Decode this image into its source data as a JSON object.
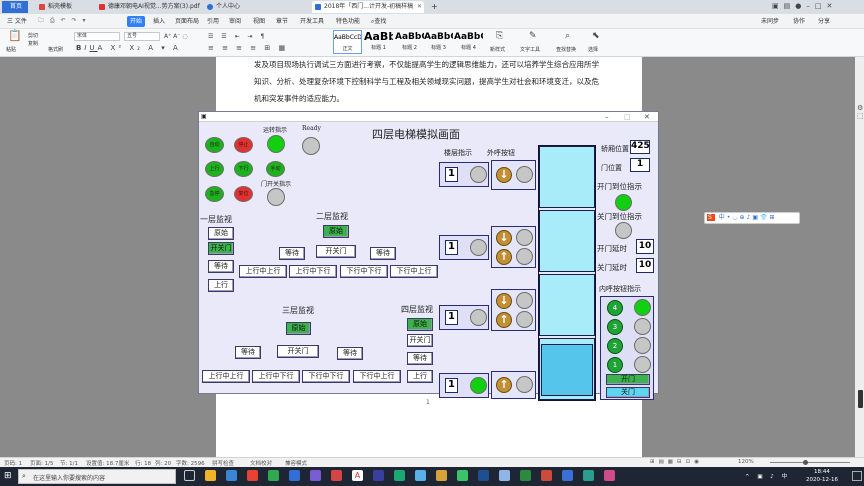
{
  "browser": {
    "tabs": [
      {
        "label": "首页",
        "active": false
      },
      {
        "label": "稻壳模板",
        "active": false
      },
      {
        "label": "德康邓朝电AI视觉...势方案(3).pdf",
        "active": false
      },
      {
        "label": "个人中心",
        "active": false
      },
      {
        "label": "2018年「西门...计开发-初稿样稿",
        "active": true
      }
    ],
    "new_tab": "+"
  },
  "menu": {
    "items": [
      "三 文件",
      "开始",
      "插入",
      "页面布局",
      "引用",
      "审阅",
      "视图",
      "章节",
      "开发工具",
      "特色功能"
    ],
    "active": "开始",
    "search_label": "查找",
    "right": [
      "未同步",
      "协作",
      "分享"
    ]
  },
  "ribbon": {
    "clipboard": [
      "粘贴",
      "剪切",
      "复制",
      "格式刷"
    ],
    "font_name": "宋体",
    "font_size": "五号",
    "styles": [
      {
        "sample": "AaBbCcDd",
        "name": "正文"
      },
      {
        "sample": "AaBb",
        "name": "标题 1"
      },
      {
        "sample": "AaBbC",
        "name": "标题 2"
      },
      {
        "sample": "AaBbC",
        "name": "标题 3"
      },
      {
        "sample": "AaBbC",
        "name": "标题 4"
      }
    ],
    "tools": [
      "新样式",
      "文字工具",
      "查找替换",
      "选择"
    ]
  },
  "document": {
    "lines": [
      "发及项目现场执行调试三方面进行考察，不仅能提高学生的逻辑思维能力，还可以培养学生综合应用所学",
      "知识、分析、处理复杂环境下控制科学与工程及相关领域现实问题，提高学生对社会和环境变迁，以及危",
      "机和突发事件的适应能力。"
    ],
    "page_number": "1"
  },
  "sim": {
    "title": "四层电梯模拟画面",
    "top_buttons": [
      {
        "label": "自动",
        "color": "#1db11d"
      },
      {
        "label": "停止",
        "color": "#e53030"
      },
      {
        "label": "上行",
        "color": "#1db11d"
      },
      {
        "label": "下行",
        "color": "#1db11d"
      },
      {
        "label": "急停",
        "color": "#1db11d"
      },
      {
        "label": "复位",
        "color": "#e53030"
      },
      {
        "label": "手动",
        "color": "#1db11d"
      }
    ],
    "run_label": "运转指示",
    "ready_label": "Ready",
    "door_label": "门开关指示",
    "floor1_title": "一层监视",
    "floor1_items": [
      "原始",
      "开关门",
      "等待",
      "上行"
    ],
    "floor2_title": "二层监视",
    "floor2_items": [
      "原始",
      "等待",
      "开关门",
      "等待"
    ],
    "floor2_bottom": [
      "上行中上行",
      "上行中下行",
      "下行中下行",
      "下行中上行"
    ],
    "floor3_title": "三层监视",
    "floor3_items": [
      "原始",
      "等待",
      "开关门",
      "等待"
    ],
    "floor3_bottom": [
      "上行中上行",
      "上行中下行",
      "下行中下行",
      "下行中上行"
    ],
    "floor4_title": "四层监视",
    "floor4_items": [
      "原始",
      "开关门",
      "等待",
      "上行"
    ],
    "floor_indicator_label": "楼层指示",
    "call_button_label": "外呼按钮",
    "floor_indicators": [
      "1",
      "1",
      "1",
      "1"
    ],
    "right": {
      "pos_label": "轿厢位置",
      "pos_value": "425",
      "door_pos_label": "门位置",
      "door_pos_value": "1",
      "open_done_label": "开门到位指示",
      "close_done_label": "关门到位指示",
      "open_delay_label": "开门延时",
      "open_delay_value": "10",
      "close_delay_label": "关门延时",
      "close_delay_value": "10",
      "inner_title": "内呼按钮指示",
      "inner_floors": [
        "4",
        "3",
        "2",
        "1"
      ],
      "open_btn": "开门",
      "close_btn": "关门"
    }
  },
  "statusbar": {
    "left": [
      "页码: 1",
      "页面: 1/5",
      "节: 1/1",
      "设置值: 18.7厘米",
      "行: 18",
      "列: 20",
      "字数: 2596",
      "拼写检查",
      "文档校对",
      "兼容模式"
    ],
    "zoom": "120%"
  },
  "taskbar": {
    "search_placeholder": "在这里输入你要搜索的内容",
    "time": "18:44",
    "date": "2020-12-16",
    "lang": "中"
  }
}
